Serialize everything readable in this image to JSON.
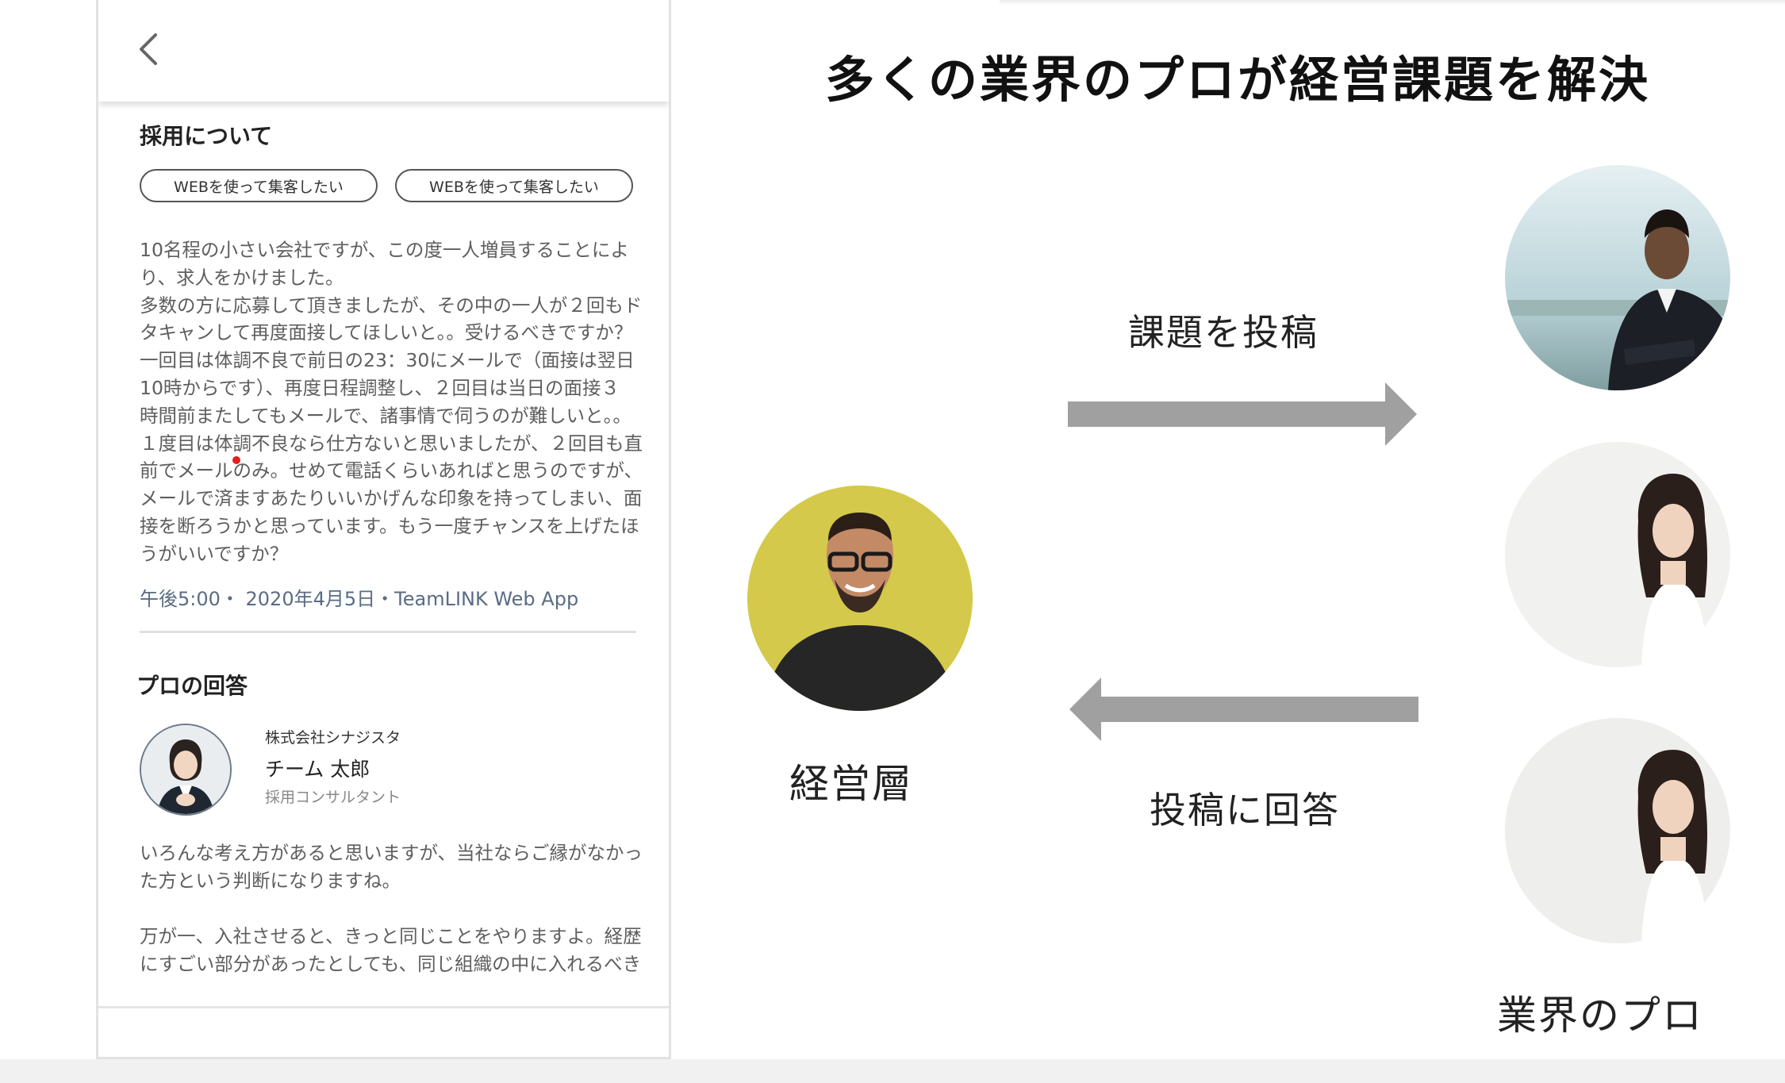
{
  "phone": {
    "back_icon": "chevron-left-icon",
    "section_recruit_title": "採用について",
    "tags": [
      "WEBを使って集客したい",
      "WEBを使って集客したい"
    ],
    "question_body": "10名程の小さい会社ですが、この度一人増員することによ\nり、求人をかけました。\n多数の方に応募して頂きましたが、その中の一人が２回もド\nタキャンして再度面接してほしいと。。受けるべきですか？\n一回目は体調不良で前日の23：30にメールで（面接は翌日\n10時からです）、再度日程調整し、２回目は当日の面接３\n時間前またしてもメールで、諸事情で伺うのが難しいと。。\n１度目は体調不良なら仕方ないと思いましたが、２回目も直\n前でメールのみ。せめて電話くらいあればと思うのですが、\nメールで済ますあたりいいかげんな印象を持ってしまい、面\n接を断ろうかと思っています。もう一度チャンスを上げたほ\nうがいいですか？",
    "meta": "午後5:00・ 2020年4月5日・TeamLINK Web App",
    "answer_section_title": "プロの回答",
    "answer": {
      "company": "株式会社シナジスタ",
      "name": "チーム 太郎",
      "role": "採用コンサルタント",
      "text_1": "いろんな考え方があると思いますが、当社ならご縁がなかっ\nた方という判断になりますね。",
      "text_2": "万が一、入社させると、きっと同じことをやりますよ。経歴\nにすごい部分があったとしても、同じ組織の中に入れるべき"
    }
  },
  "diagram": {
    "title": "多くの業界のプロが経営課題を解決",
    "executive_label": "経営層",
    "arrow_top_label": "課題を投稿",
    "arrow_bottom_label": "投稿に回答",
    "pros_label": "業界のプロ",
    "colors": {
      "arrow": "#a0a0a0",
      "executive_bg": "#d4c94a",
      "title": "#111111"
    }
  }
}
